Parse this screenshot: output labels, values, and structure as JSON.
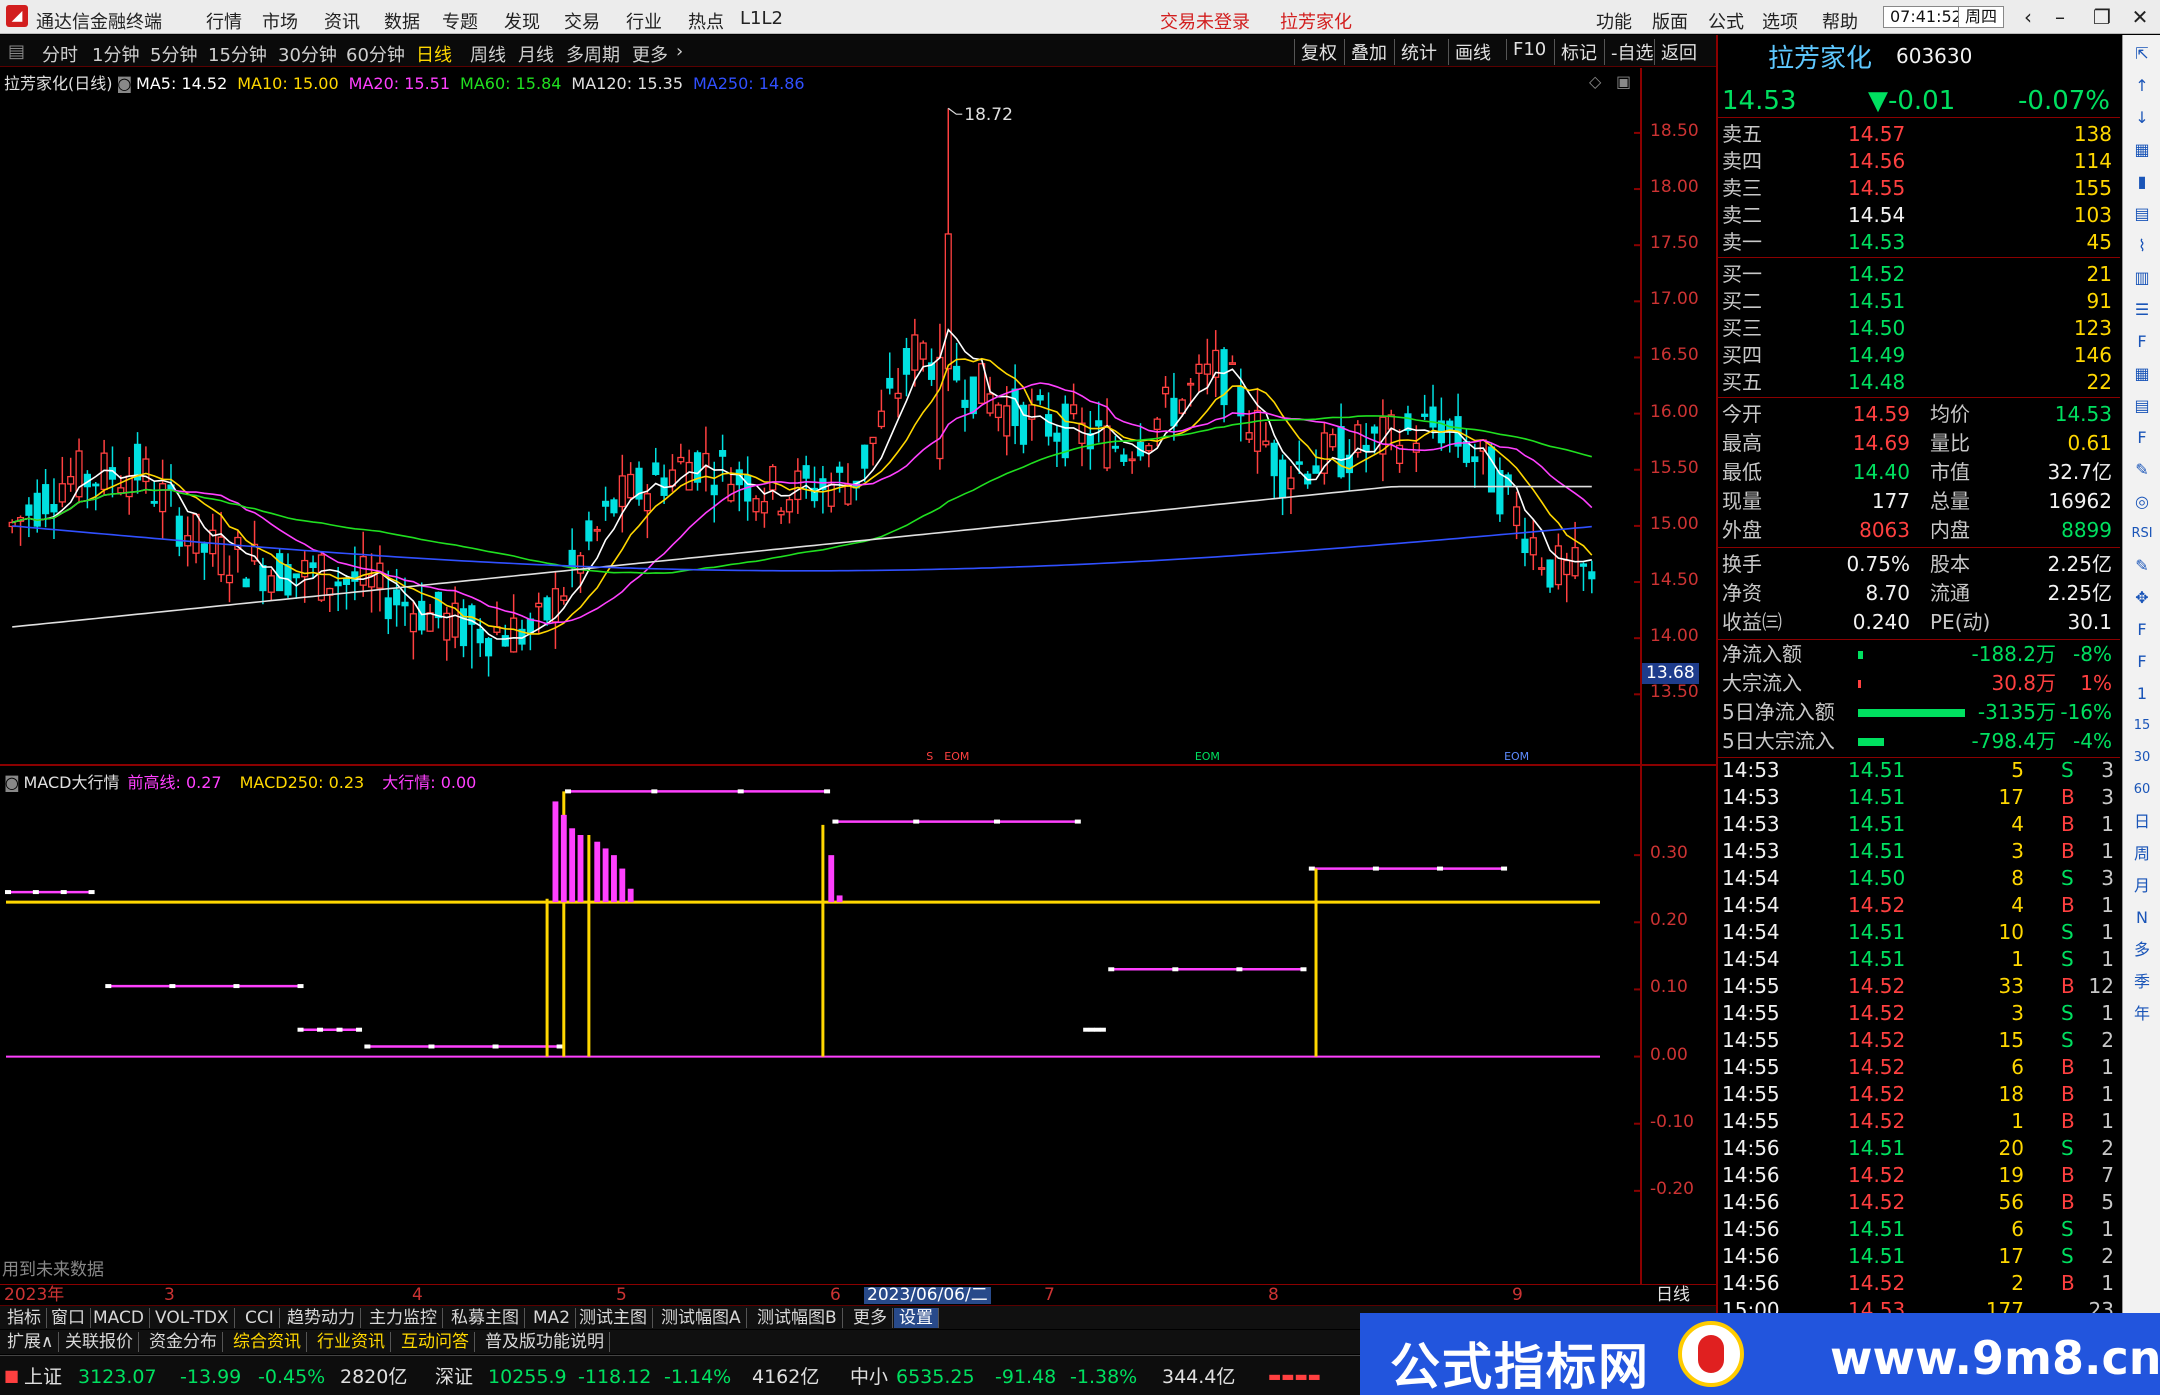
{
  "titlebar": {
    "app_title": "通达信金融终端",
    "menu": [
      "行情",
      "市场",
      "资讯",
      "数据",
      "专题",
      "发现",
      "交易",
      "行业",
      "热点",
      "L1L2"
    ],
    "login_status": "交易未登录",
    "stock_name": "拉芳家化",
    "right_menu": [
      "功能",
      "版面",
      "公式",
      "选项",
      "帮助"
    ],
    "time": "07:41:52",
    "weekday": "周四"
  },
  "periods": [
    "分时",
    "1分钟",
    "5分钟",
    "15分钟",
    "30分钟",
    "60分钟",
    "日线",
    "周线",
    "月线",
    "多周期",
    "更多"
  ],
  "active_period": "日线",
  "toolbar_right": [
    "复权",
    "叠加",
    "统计",
    "画线",
    "F10",
    "标记",
    "-自选",
    "返回"
  ],
  "kchart": {
    "title": "拉芳家化(日线)",
    "ma": [
      {
        "label": "MA5: 14.52",
        "color": "#ffffff"
      },
      {
        "label": "MA10: 15.00",
        "color": "#ffd700"
      },
      {
        "label": "MA20: 15.51",
        "color": "#ff40ff"
      },
      {
        "label": "MA60: 15.84",
        "color": "#20e020"
      },
      {
        "label": "MA120: 15.35",
        "color": "#e0e0e0"
      },
      {
        "label": "MA250: 14.86",
        "color": "#3050ff"
      }
    ],
    "y_ticks": [
      "18.50",
      "18.00",
      "17.50",
      "17.00",
      "16.50",
      "16.00",
      "15.50",
      "15.00",
      "14.50",
      "14.00",
      "13.50"
    ],
    "peak_label": "18.72",
    "low_label": "13.68",
    "markers": [
      "S",
      "EOM"
    ]
  },
  "chart_data": [
    {
      "type": "candlestick",
      "title": "拉芳家化(日线)",
      "ylim": [
        13.2,
        18.9
      ],
      "x_ticks": [
        "2023年",
        "3",
        "4",
        "5",
        "6",
        "7",
        "8",
        "9"
      ],
      "crosshair_date": "2023/06/06/二",
      "high": 18.72,
      "low": 13.68,
      "last_close": 14.53
    },
    {
      "type": "bar",
      "title": "MACD大行情",
      "ylim": [
        -0.3,
        0.4
      ],
      "y_ticks": [
        "0.30",
        "0.20",
        "0.10",
        "0.00",
        "-0.10",
        "-0.20"
      ],
      "series": [
        {
          "name": "前高线",
          "value": 0.27
        },
        {
          "name": "MACD250",
          "value": 0.23
        },
        {
          "name": "大行情",
          "value": 0.0
        }
      ]
    }
  ],
  "macd": {
    "title": "MACD大行情",
    "legend": [
      {
        "label": "前高线: 0.27",
        "color": "#ff40ff"
      },
      {
        "label": "MACD250: 0.23",
        "color": "#ffd700"
      },
      {
        "label": "大行情: 0.00",
        "color": "#ff40ff"
      }
    ],
    "y_ticks": [
      "0.30",
      "0.20",
      "0.10",
      "0.00",
      "-0.10",
      "-0.20"
    ],
    "footnote": "用到未来数据"
  },
  "dateaxis": {
    "labels": [
      "2023年",
      "3",
      "4",
      "5",
      "6",
      "2023/06/06/二",
      "7",
      "8",
      "9"
    ],
    "right_label": "日线"
  },
  "quote": {
    "name": "拉芳家化",
    "code": "603630",
    "price": "14.53",
    "change": "▼-0.01",
    "change_pct": "-0.07%",
    "asks": [
      {
        "label": "卖五",
        "price": "14.57",
        "vol": "138"
      },
      {
        "label": "卖四",
        "price": "14.56",
        "vol": "114"
      },
      {
        "label": "卖三",
        "price": "14.55",
        "vol": "155"
      },
      {
        "label": "卖二",
        "price": "14.54",
        "vol": "103"
      },
      {
        "label": "卖一",
        "price": "14.53",
        "vol": "45"
      }
    ],
    "bids": [
      {
        "label": "买一",
        "price": "14.52",
        "vol": "21"
      },
      {
        "label": "买二",
        "price": "14.51",
        "vol": "91"
      },
      {
        "label": "买三",
        "price": "14.50",
        "vol": "123"
      },
      {
        "label": "买四",
        "price": "14.49",
        "vol": "146"
      },
      {
        "label": "买五",
        "price": "14.48",
        "vol": "22"
      }
    ],
    "stats": [
      {
        "l1": "今开",
        "v1": "14.59",
        "l2": "均价",
        "v2": "14.53",
        "c1": "red",
        "c2": "green"
      },
      {
        "l1": "最高",
        "v1": "14.69",
        "l2": "量比",
        "v2": "0.61",
        "c1": "red",
        "c2": "yellow"
      },
      {
        "l1": "最低",
        "v1": "14.40",
        "l2": "市值",
        "v2": "32.7亿",
        "c1": "green",
        "c2": "white"
      },
      {
        "l1": "现量",
        "v1": "177",
        "l2": "总量",
        "v2": "16962",
        "c1": "white",
        "c2": "white"
      },
      {
        "l1": "外盘",
        "v1": "8063",
        "l2": "内盘",
        "v2": "8899",
        "c1": "red",
        "c2": "green"
      }
    ],
    "stats2": [
      {
        "l1": "换手",
        "v1": "0.75%",
        "l2": "股本",
        "v2": "2.25亿"
      },
      {
        "l1": "净资",
        "v1": "8.70",
        "l2": "流通",
        "v2": "2.25亿"
      },
      {
        "l1": "收益㈢",
        "v1": "0.240",
        "l2": "PE(动)",
        "v2": "30.1"
      }
    ],
    "flows": [
      {
        "label": "净流入额",
        "value": "-188.2万",
        "pct": "-8%",
        "vc": "green",
        "bar": 0.04,
        "barc": "#00e060"
      },
      {
        "label": "大宗流入",
        "value": "30.8万",
        "pct": "1%",
        "vc": "red",
        "bar": 0.01,
        "barc": "#ff4040"
      },
      {
        "label": "5日净流入额",
        "value": "-3135万",
        "pct": "-16%",
        "vc": "green",
        "bar": 0.82,
        "barc": "#00e060"
      },
      {
        "label": "5日大宗流入",
        "value": "-798.4万",
        "pct": "-4%",
        "vc": "green",
        "bar": 0.2,
        "barc": "#00e060"
      }
    ],
    "ticks": [
      {
        "t": "14:53",
        "p": "14.51",
        "v": "5",
        "d": "S",
        "n": "3"
      },
      {
        "t": "14:53",
        "p": "14.51",
        "v": "17",
        "d": "B",
        "n": "3"
      },
      {
        "t": "14:53",
        "p": "14.51",
        "v": "4",
        "d": "B",
        "n": "1"
      },
      {
        "t": "14:53",
        "p": "14.51",
        "v": "3",
        "d": "B",
        "n": "1"
      },
      {
        "t": "14:54",
        "p": "14.50",
        "v": "8",
        "d": "S",
        "n": "3"
      },
      {
        "t": "14:54",
        "p": "14.52",
        "v": "4",
        "d": "B",
        "n": "1"
      },
      {
        "t": "14:54",
        "p": "14.51",
        "v": "10",
        "d": "S",
        "n": "1"
      },
      {
        "t": "14:54",
        "p": "14.51",
        "v": "1",
        "d": "S",
        "n": "1"
      },
      {
        "t": "14:55",
        "p": "14.52",
        "v": "33",
        "d": "B",
        "n": "12"
      },
      {
        "t": "14:55",
        "p": "14.52",
        "v": "3",
        "d": "S",
        "n": "1"
      },
      {
        "t": "14:55",
        "p": "14.52",
        "v": "15",
        "d": "S",
        "n": "2"
      },
      {
        "t": "14:55",
        "p": "14.52",
        "v": "6",
        "d": "B",
        "n": "1"
      },
      {
        "t": "14:55",
        "p": "14.52",
        "v": "18",
        "d": "B",
        "n": "1"
      },
      {
        "t": "14:55",
        "p": "14.52",
        "v": "1",
        "d": "B",
        "n": "1"
      },
      {
        "t": "14:56",
        "p": "14.51",
        "v": "20",
        "d": "S",
        "n": "2"
      },
      {
        "t": "14:56",
        "p": "14.52",
        "v": "19",
        "d": "B",
        "n": "7"
      },
      {
        "t": "14:56",
        "p": "14.52",
        "v": "56",
        "d": "B",
        "n": "5"
      },
      {
        "t": "14:56",
        "p": "14.51",
        "v": "6",
        "d": "S",
        "n": "1"
      },
      {
        "t": "14:56",
        "p": "14.51",
        "v": "17",
        "d": "S",
        "n": "2"
      },
      {
        "t": "14:56",
        "p": "14.52",
        "v": "2",
        "d": "B",
        "n": "1"
      },
      {
        "t": "15:00",
        "p": "14.53",
        "v": "177",
        "d": "",
        "n": "23"
      }
    ]
  },
  "sidebar_icons": [
    "collapse-icon",
    "up-arrow-icon",
    "down-arrow-icon",
    "minute-chart-icon",
    "kline-icon",
    "table-icon",
    "trend-icon",
    "bar-icon",
    "list-icon",
    "f10-icon",
    "grid-icon",
    "doc-icon",
    "f2-icon",
    "chart-icon",
    "circle-icon",
    "rsi-icon",
    "pen-icon",
    "cross-icon",
    "f5-icon",
    "f6-icon",
    "1-icon",
    "15-icon",
    "30-icon",
    "60-icon",
    "day-icon",
    "week-icon",
    "month-icon",
    "n-icon",
    "multi-icon",
    "season-icon",
    "year-icon"
  ],
  "sidebar_labels": [
    "RSI",
    "1",
    "15",
    "30",
    "60",
    "日",
    "周",
    "月",
    "N",
    "多",
    "季",
    "年"
  ],
  "tabs1": [
    "指标",
    "窗口",
    "MACD",
    "VOL-TDX",
    "CCI",
    "趋势动力",
    "主力监控",
    "私募主图",
    "MA2",
    "测试主图",
    "测试幅图A",
    "测试幅图B",
    "更多",
    "设置"
  ],
  "tabs2": [
    "扩展∧",
    "关联报价",
    "资金分布",
    "综合资讯",
    "行业资讯",
    "互动问答",
    "普及版功能说明"
  ],
  "status": {
    "sh_label": "上证",
    "sh_val": "3123.07",
    "sh_chg": "-13.99",
    "sh_pct": "-0.45%",
    "sh_amt": "2820亿",
    "sz_label": "深证",
    "sz_val": "10255.9",
    "sz_chg": "-118.12",
    "sz_pct": "-1.14%",
    "sz_amt": "4162亿",
    "zx_label": "中小",
    "zx_val": "6535.25",
    "zx_chg": "-91.48",
    "zx_pct": "-1.38%",
    "zx_amt": "344.4亿"
  },
  "banner": {
    "text": "公式指标网",
    "url": "www.9m8.cn"
  },
  "colors": {
    "up": "#ff4040",
    "down": "#00e0e0",
    "axis": "#8b0000",
    "ma5": "#ffffff",
    "ma10": "#ffd700",
    "ma20": "#ff40ff",
    "ma60": "#20e020",
    "ma120": "#e0e0e0",
    "ma250": "#3050ff"
  }
}
